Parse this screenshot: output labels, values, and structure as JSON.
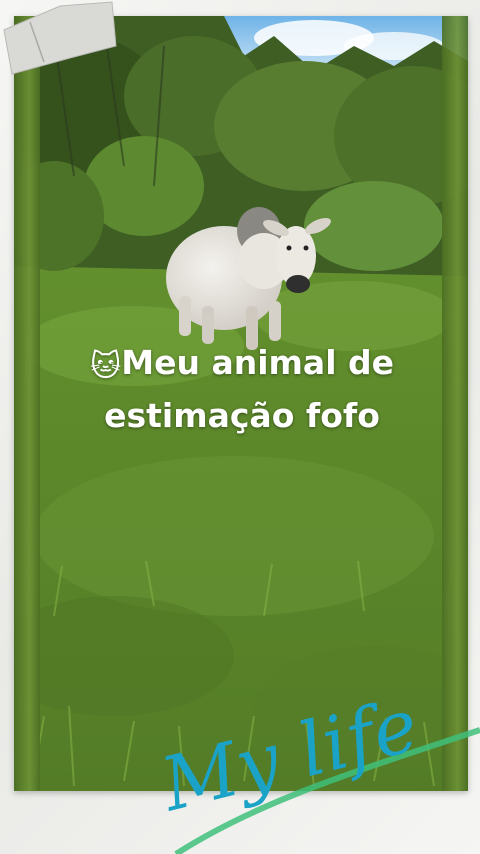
{
  "caption": {
    "emoji": "🐱",
    "line1": "Meu animal de",
    "line2": "estimação fofo"
  },
  "handwritten": "My life",
  "colors": {
    "caption_text": "#ffffff",
    "script_text": "#1aa3c6",
    "script_stroke": "#3fbf7a",
    "grass": "#5c7f2c",
    "sky": "#8fc6ea"
  }
}
